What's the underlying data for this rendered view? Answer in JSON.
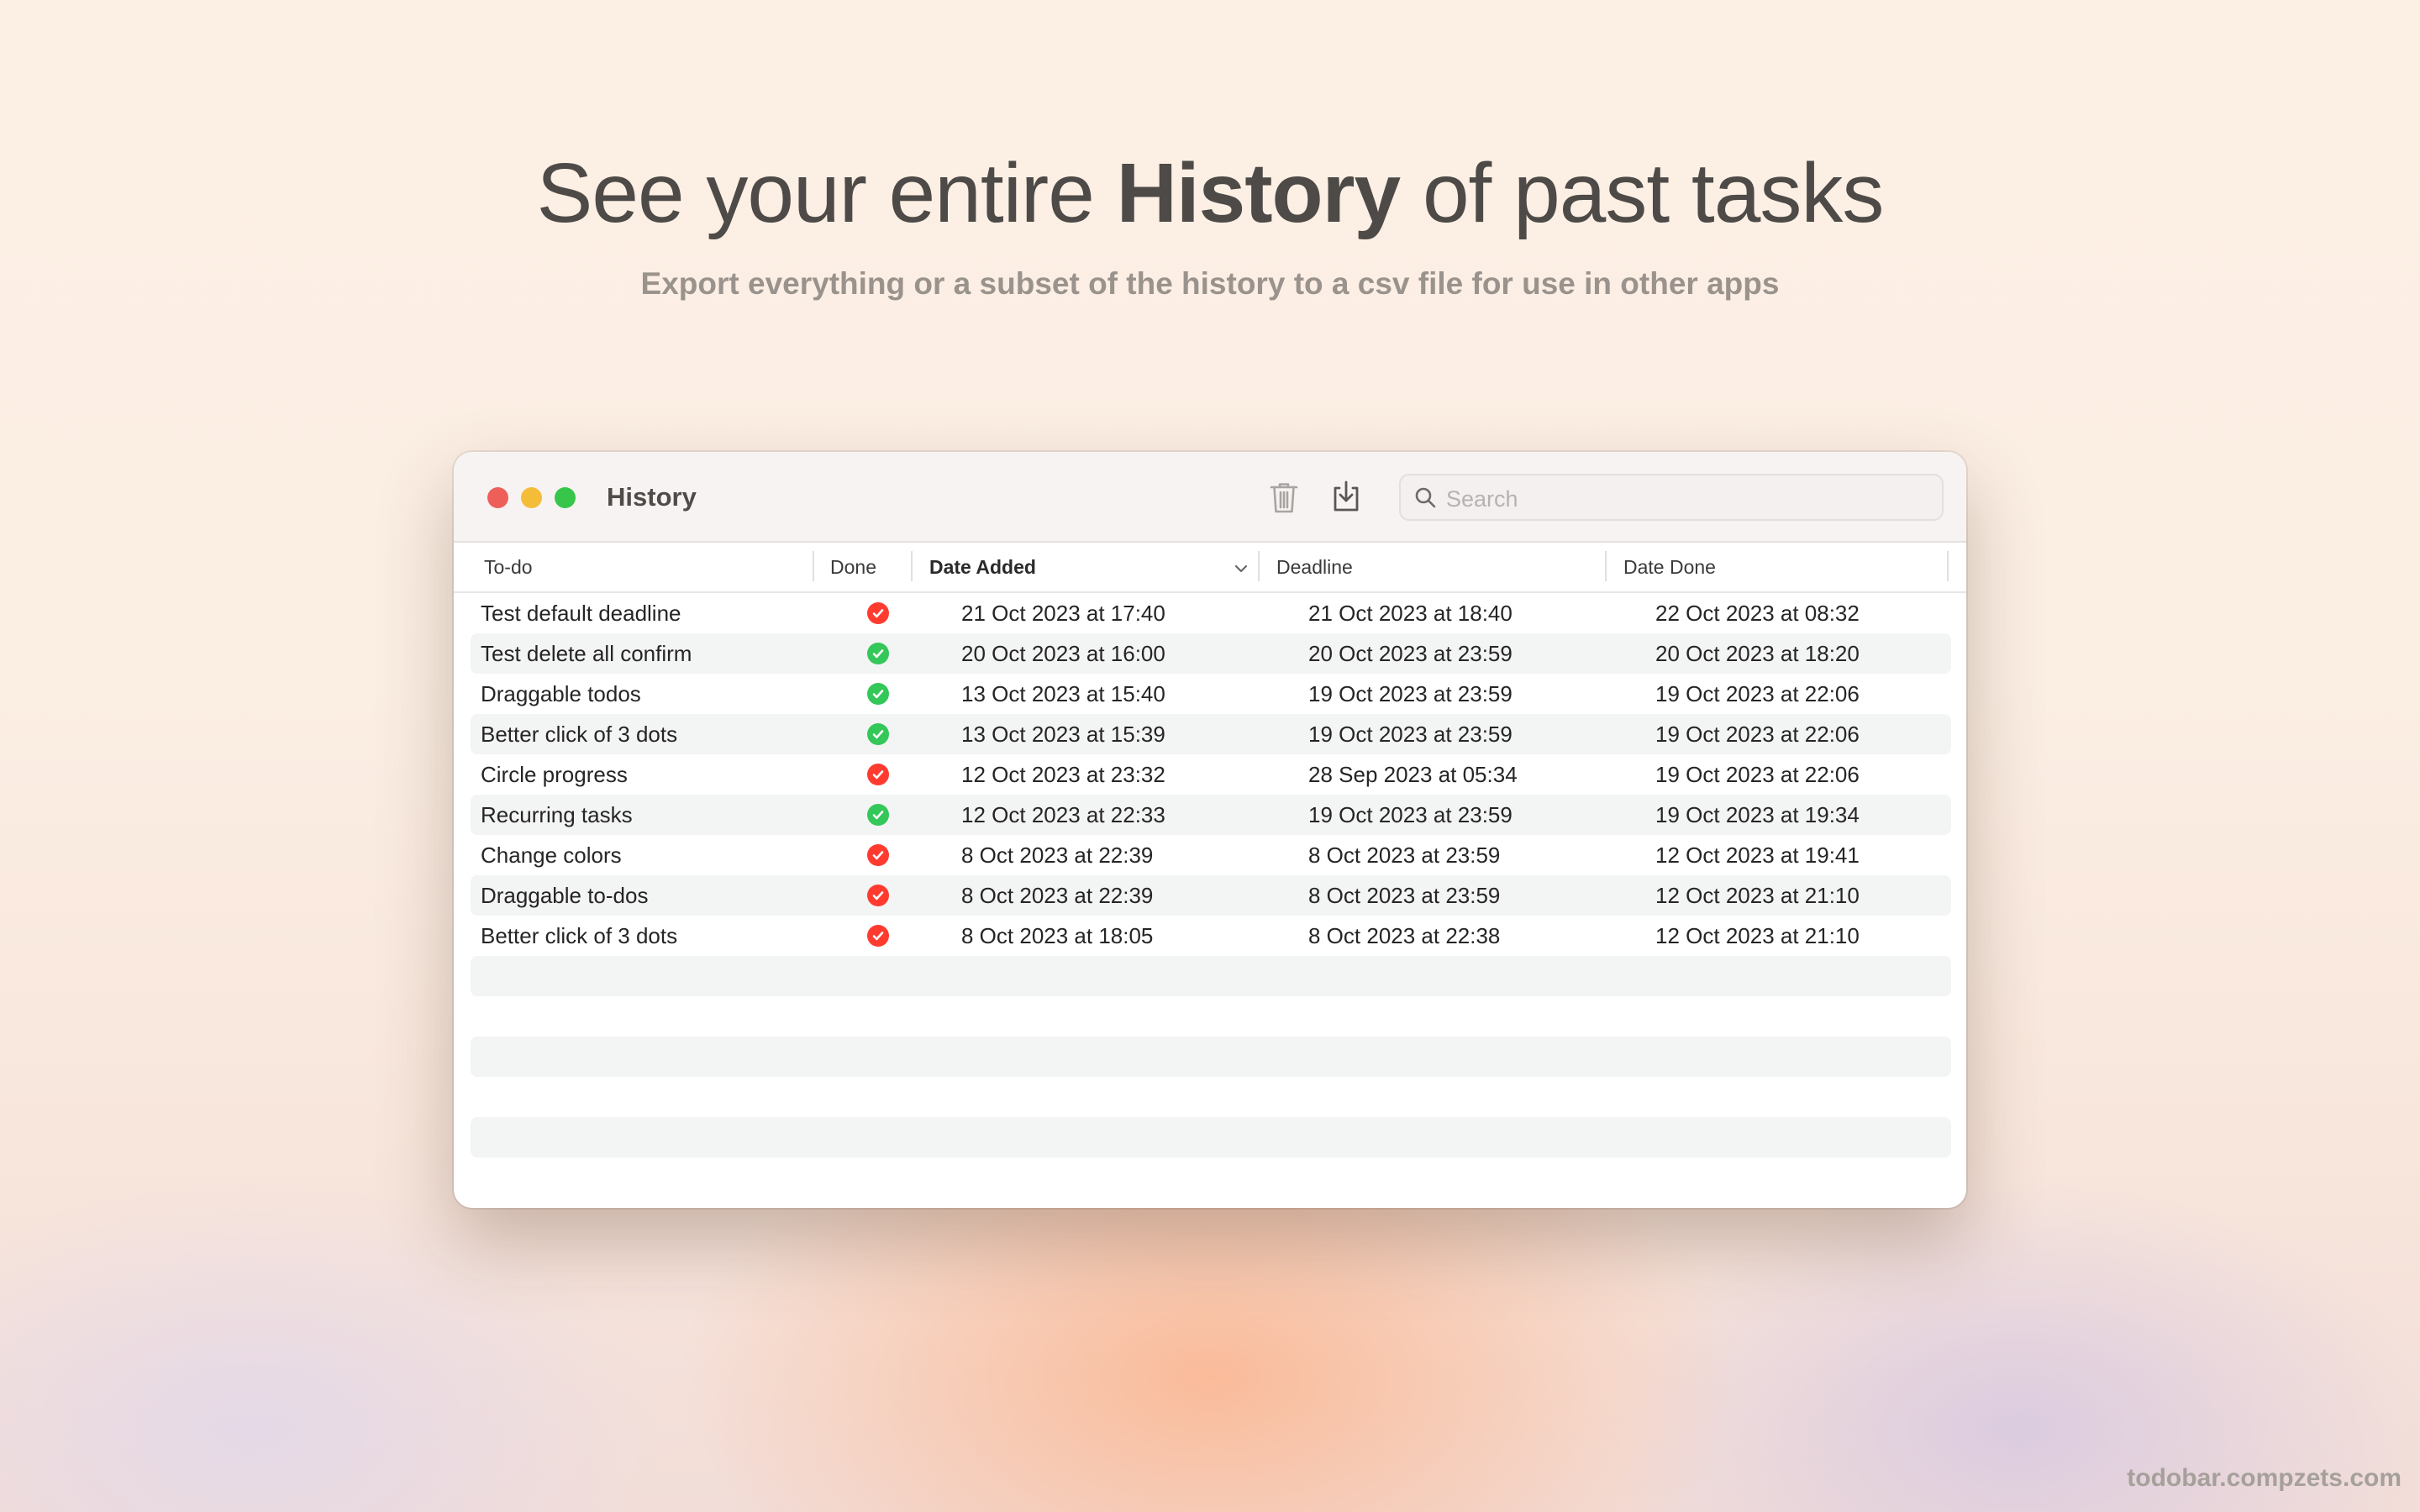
{
  "hero": {
    "title_before": "See your entire ",
    "title_bold": "History",
    "title_after": " of past tasks",
    "subtitle": "Export everything or a subset of the history to a csv file for use in other apps"
  },
  "window": {
    "title": "History",
    "toolbar": {
      "trash_icon": "trash-icon",
      "export_icon": "export-icon"
    },
    "search": {
      "placeholder": "Search",
      "value": ""
    }
  },
  "table": {
    "columns": [
      {
        "label": "To-do"
      },
      {
        "label": "Done"
      },
      {
        "label": "Date Added",
        "sorted": true,
        "sort_direction": "descending"
      },
      {
        "label": "Deadline"
      },
      {
        "label": "Date Done"
      }
    ],
    "rows": [
      {
        "todo": "Test default deadline",
        "done": false,
        "date_added": "21 Oct 2023 at 17:40",
        "deadline": "21 Oct 2023 at 18:40",
        "date_done": "22 Oct 2023 at 08:32"
      },
      {
        "todo": "Test delete all confirm",
        "done": true,
        "date_added": "20 Oct 2023 at 16:00",
        "deadline": "20 Oct 2023 at 23:59",
        "date_done": "20 Oct 2023 at 18:20"
      },
      {
        "todo": "Draggable todos",
        "done": true,
        "date_added": "13 Oct 2023 at 15:40",
        "deadline": "19 Oct 2023 at 23:59",
        "date_done": "19 Oct 2023 at 22:06"
      },
      {
        "todo": "Better click of 3 dots",
        "done": true,
        "date_added": "13 Oct 2023 at 15:39",
        "deadline": "19 Oct 2023 at 23:59",
        "date_done": "19 Oct 2023 at 22:06"
      },
      {
        "todo": "Circle progress",
        "done": false,
        "date_added": "12 Oct 2023 at 23:32",
        "deadline": "28 Sep 2023 at 05:34",
        "date_done": "19 Oct 2023 at 22:06"
      },
      {
        "todo": "Recurring tasks",
        "done": true,
        "date_added": "12 Oct 2023 at 22:33",
        "deadline": "19 Oct 2023 at 23:59",
        "date_done": "19 Oct 2023 at 19:34"
      },
      {
        "todo": "Change colors",
        "done": false,
        "date_added": "8 Oct 2023 at 22:39",
        "deadline": "8 Oct 2023 at 23:59",
        "date_done": "12 Oct 2023 at 19:41"
      },
      {
        "todo": "Draggable to-dos",
        "done": false,
        "date_added": "8 Oct 2023 at 22:39",
        "deadline": "8 Oct 2023 at 23:59",
        "date_done": "12 Oct 2023 at 21:10"
      },
      {
        "todo": "Better click of 3 dots",
        "done": false,
        "date_added": "8 Oct 2023 at 18:05",
        "deadline": "8 Oct 2023 at 22:38",
        "date_done": "12 Oct 2023 at 21:10"
      }
    ],
    "empty_rows": 6,
    "status_colors": {
      "done": "#34c759",
      "not_done": "#ff3b30"
    }
  },
  "footer": {
    "url": "todobar.compzets.com"
  }
}
